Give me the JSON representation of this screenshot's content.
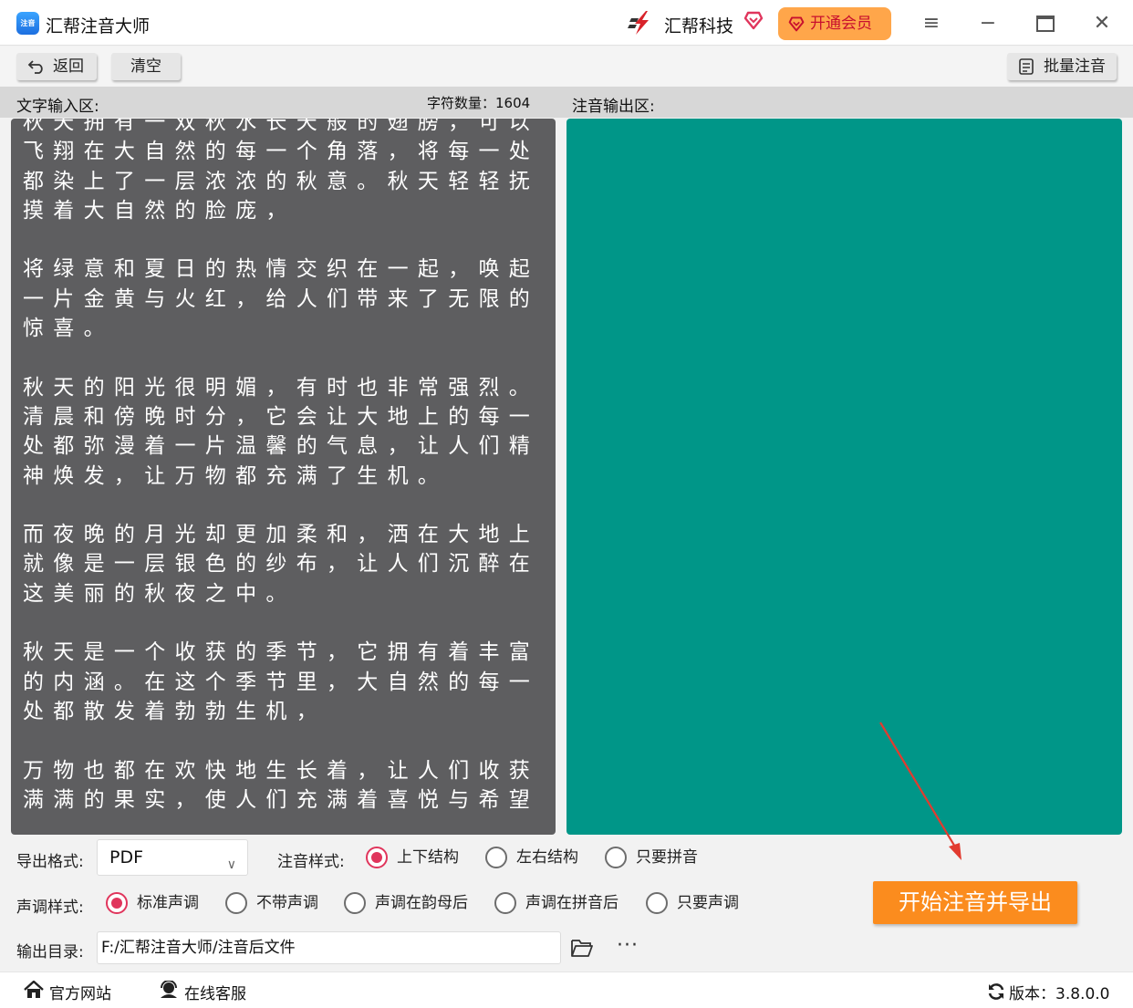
{
  "app": {
    "title": "汇帮注音大师",
    "logo_text": "注音",
    "brand": "汇帮科技",
    "vip_label": "开通会员"
  },
  "toolbar": {
    "back_label": "返回",
    "clear_label": "清空",
    "batch_label": "批量注音"
  },
  "input_area": {
    "label": "文字输入区:",
    "char_count": "字符数量：1604",
    "text": "秋天拥有一双秋水长天般的翅膀，可以飞翔在大自然的每一个角落，将每一处都染上了一层浓浓的秋意。秋天轻轻抚摸着大自然的脸庞，\n\n将绿意和夏日的热情交织在一起，唤起一片金黄与火红，给人们带来了无限的惊喜。\n\n秋天的阳光很明媚，有时也非常强烈。清晨和傍晚时分，它会让大地上的每一处都弥漫着一片温馨的气息，让人们精神焕发，让万物都充满了生机。\n\n而夜晚的月光却更加柔和，洒在大地上就像是一层银色的纱布，让人们沉醉在这美丽的秋夜之中。\n\n秋天是一个收获的季节，它拥有着丰富的内涵。在这个季节里，大自然的每一处都散发着勃勃生机，\n\n万物也都在欢快地生长着，让人们收获满满的果实，使人们充满着喜悦与希望"
  },
  "output_area": {
    "label": "注音输出区:",
    "background": "#009688"
  },
  "options": {
    "format_label": "导出格式:",
    "format_value": "PDF",
    "style_label": "注音样式:",
    "style_options": [
      {
        "label": "上下结构",
        "selected": true
      },
      {
        "label": "左右结构",
        "selected": false
      },
      {
        "label": "只要拼音",
        "selected": false
      }
    ],
    "tone_label": "声调样式:",
    "tone_options": [
      {
        "label": "标准声调",
        "selected": true
      },
      {
        "label": "不带声调",
        "selected": false
      },
      {
        "label": "声调在韵母后",
        "selected": false
      },
      {
        "label": "声调在拼音后",
        "selected": false
      },
      {
        "label": "只要声调",
        "selected": false
      }
    ],
    "dir_label": "输出目录:",
    "dir_value": "F:/汇帮注音大师/注音后文件",
    "more_label": "···",
    "start_label": "开始注音并导出"
  },
  "statusbar": {
    "website_label": "官方网站",
    "service_label": "在线客服",
    "version": "版本：3.8.0.0"
  },
  "colors": {
    "accent": "#fb8c1e",
    "radio_selected": "#e0355c",
    "vip": "#ffa64a"
  }
}
